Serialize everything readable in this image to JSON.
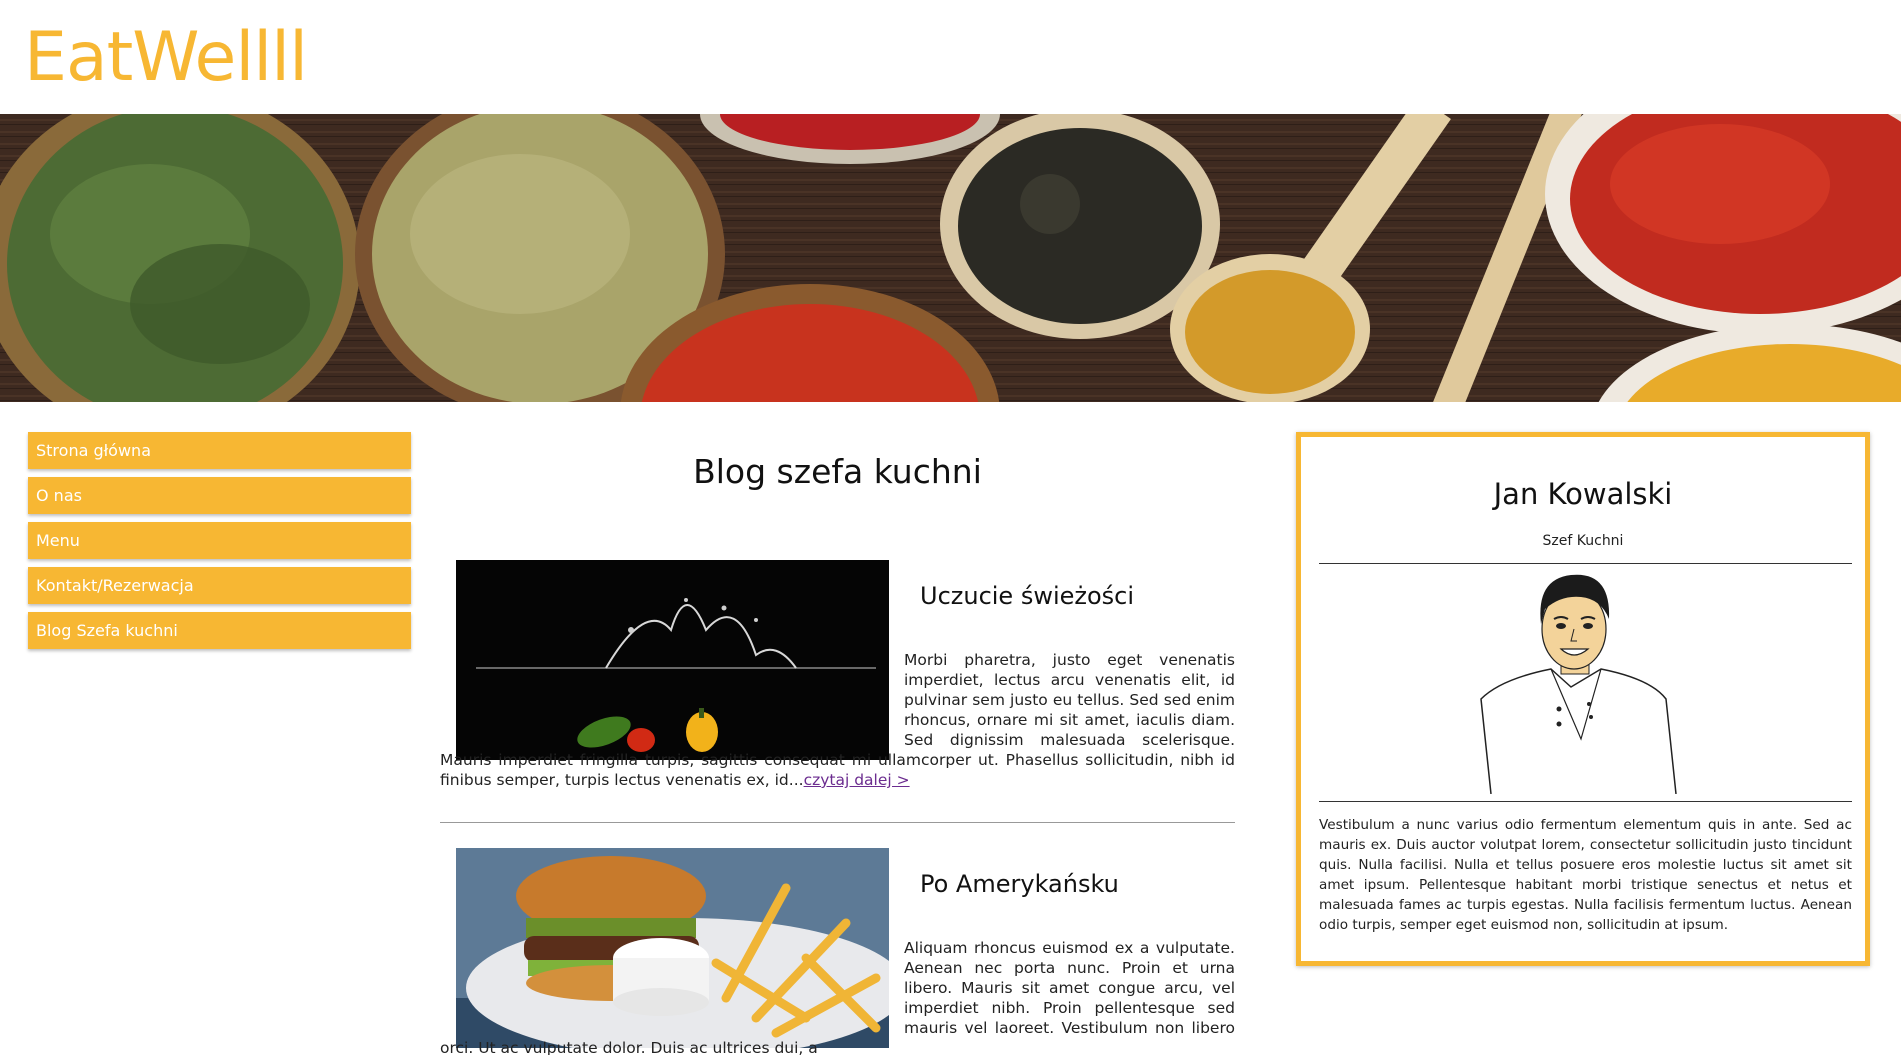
{
  "header": {
    "logo_text": "EatWellll"
  },
  "nav": {
    "items": [
      {
        "label": "Strona główna"
      },
      {
        "label": "O nas"
      },
      {
        "label": "Menu"
      },
      {
        "label": "Kontakt/Rezerwacja"
      },
      {
        "label": "Blog Szefa kuchni"
      }
    ]
  },
  "main": {
    "title": "Blog szefa kuchni",
    "posts": [
      {
        "title": "Uczucie świeżości",
        "body": "Morbi pharetra, justo eget venenatis imperdiet, lectus arcu venenatis elit, id pulvinar sem justo eu tellus. Sed sed enim rhoncus, ornare mi sit amet, iaculis diam. Sed dignissim malesuada scelerisque. Mauris imperdiet fringilla turpis, sagittis consequat mi ullamcorper ut. Phasellus sollicitudin, nibh id finibus semper, turpis lectus venenatis ex, id...",
        "read_more": "czytaj dalej >"
      },
      {
        "title": "Po Amerykańsku",
        "body": "Aliquam rhoncus euismod ex a vulputate. Aenean nec porta nunc. Proin et urna libero. Mauris sit amet congue arcu, vel imperdiet nibh. Proin pellentesque sed mauris vel laoreet. Vestibulum non libero orci. Ut ac vulputate dolor. Duis ac ultrices dui, a"
      }
    ]
  },
  "chef": {
    "name": "Jan Kowalski",
    "role": "Szef Kuchni",
    "bio": "Vestibulum a nunc varius odio fermentum elementum quis in ante. Sed ac mauris ex. Duis auctor volutpat lorem, consectetur sollicitudin justo tincidunt quis. Nulla facilisi. Nulla et tellus posuere eros molestie luctus sit amet sit amet ipsum. Pellentesque habitant morbi tristique senectus et netus et malesuada fames ac turpis egestas. Nulla facilisis fermentum luctus. Aenean odio turpis, semper eget euismod non, sollicitudin at ipsum."
  },
  "colors": {
    "accent": "#f7b733",
    "link": "#6b2c8f"
  }
}
